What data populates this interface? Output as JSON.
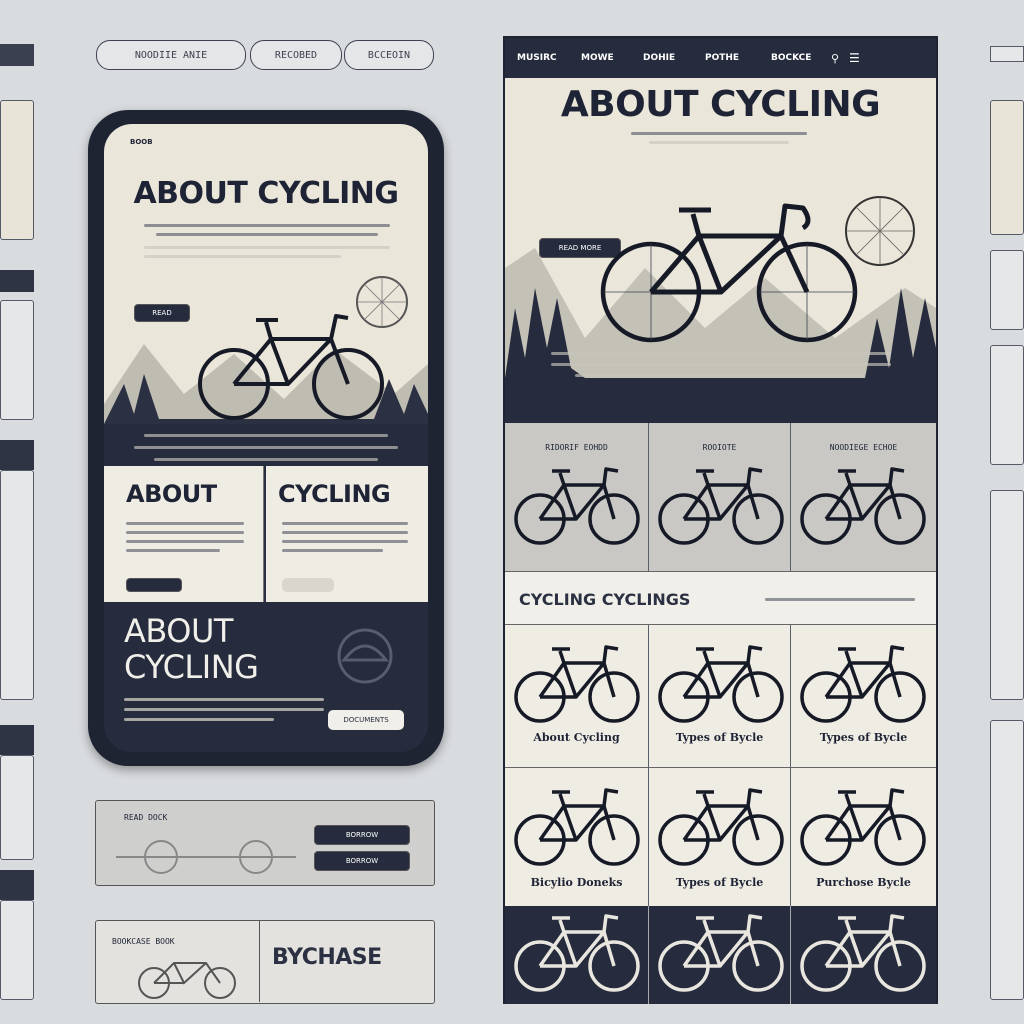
{
  "top_pills": [
    "NOODIIE ANIE",
    "RECOBED",
    "BCCEOIN"
  ],
  "phone": {
    "status_label": "BOOB",
    "hero_title": "ABOUT CYCLING",
    "hero_button": "READ",
    "cards": [
      {
        "title": "ABOUT"
      },
      {
        "title": "CYCLING"
      }
    ],
    "lower_title_line1": "ABOUT",
    "lower_title_line2": "CYCLING",
    "lower_button": "DOCUMENTS"
  },
  "desktop": {
    "nav": [
      "MUSIRC",
      "MOWE",
      "DOHIE",
      "POTHE",
      "BOCKCE"
    ],
    "hero_title": "ABOUT CYCLING",
    "hero_button": "READ MORE",
    "tiles": [
      "RIDORIF EOHDD",
      "ROOIOTE",
      "NOODIEGE ECHOE"
    ],
    "section_title": "CYCLING CYCLINGS",
    "row1_captions": [
      "About Cycling",
      "Types of Bycle",
      "Types of Bycle"
    ],
    "row2_captions": [
      "Bicylio Doneks",
      "Types of Bycle",
      "Purchose Bycle"
    ]
  },
  "bottom_cards": {
    "card1_label": "READ DOCK",
    "card1_buttons": [
      "BORROW",
      "BORROW"
    ],
    "card2_label": "BOOKCASE BOOK",
    "card2_title": "BYCHASE"
  },
  "icons": [
    "menu-icon",
    "search-icon",
    "bicycle-icon",
    "wheel-icon",
    "home-icon",
    "gear-icon"
  ]
}
